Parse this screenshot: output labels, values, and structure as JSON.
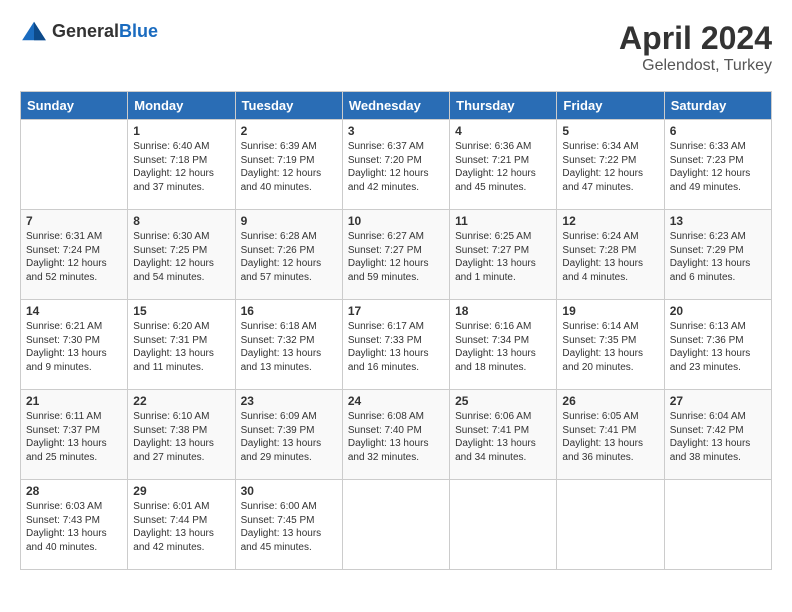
{
  "header": {
    "logo_general": "General",
    "logo_blue": "Blue",
    "month": "April 2024",
    "location": "Gelendost, Turkey"
  },
  "days_of_week": [
    "Sunday",
    "Monday",
    "Tuesday",
    "Wednesday",
    "Thursday",
    "Friday",
    "Saturday"
  ],
  "weeks": [
    [
      {
        "day": "",
        "info": ""
      },
      {
        "day": "1",
        "info": "Sunrise: 6:40 AM\nSunset: 7:18 PM\nDaylight: 12 hours\nand 37 minutes."
      },
      {
        "day": "2",
        "info": "Sunrise: 6:39 AM\nSunset: 7:19 PM\nDaylight: 12 hours\nand 40 minutes."
      },
      {
        "day": "3",
        "info": "Sunrise: 6:37 AM\nSunset: 7:20 PM\nDaylight: 12 hours\nand 42 minutes."
      },
      {
        "day": "4",
        "info": "Sunrise: 6:36 AM\nSunset: 7:21 PM\nDaylight: 12 hours\nand 45 minutes."
      },
      {
        "day": "5",
        "info": "Sunrise: 6:34 AM\nSunset: 7:22 PM\nDaylight: 12 hours\nand 47 minutes."
      },
      {
        "day": "6",
        "info": "Sunrise: 6:33 AM\nSunset: 7:23 PM\nDaylight: 12 hours\nand 49 minutes."
      }
    ],
    [
      {
        "day": "7",
        "info": "Sunrise: 6:31 AM\nSunset: 7:24 PM\nDaylight: 12 hours\nand 52 minutes."
      },
      {
        "day": "8",
        "info": "Sunrise: 6:30 AM\nSunset: 7:25 PM\nDaylight: 12 hours\nand 54 minutes."
      },
      {
        "day": "9",
        "info": "Sunrise: 6:28 AM\nSunset: 7:26 PM\nDaylight: 12 hours\nand 57 minutes."
      },
      {
        "day": "10",
        "info": "Sunrise: 6:27 AM\nSunset: 7:27 PM\nDaylight: 12 hours\nand 59 minutes."
      },
      {
        "day": "11",
        "info": "Sunrise: 6:25 AM\nSunset: 7:27 PM\nDaylight: 13 hours\nand 1 minute."
      },
      {
        "day": "12",
        "info": "Sunrise: 6:24 AM\nSunset: 7:28 PM\nDaylight: 13 hours\nand 4 minutes."
      },
      {
        "day": "13",
        "info": "Sunrise: 6:23 AM\nSunset: 7:29 PM\nDaylight: 13 hours\nand 6 minutes."
      }
    ],
    [
      {
        "day": "14",
        "info": "Sunrise: 6:21 AM\nSunset: 7:30 PM\nDaylight: 13 hours\nand 9 minutes."
      },
      {
        "day": "15",
        "info": "Sunrise: 6:20 AM\nSunset: 7:31 PM\nDaylight: 13 hours\nand 11 minutes."
      },
      {
        "day": "16",
        "info": "Sunrise: 6:18 AM\nSunset: 7:32 PM\nDaylight: 13 hours\nand 13 minutes."
      },
      {
        "day": "17",
        "info": "Sunrise: 6:17 AM\nSunset: 7:33 PM\nDaylight: 13 hours\nand 16 minutes."
      },
      {
        "day": "18",
        "info": "Sunrise: 6:16 AM\nSunset: 7:34 PM\nDaylight: 13 hours\nand 18 minutes."
      },
      {
        "day": "19",
        "info": "Sunrise: 6:14 AM\nSunset: 7:35 PM\nDaylight: 13 hours\nand 20 minutes."
      },
      {
        "day": "20",
        "info": "Sunrise: 6:13 AM\nSunset: 7:36 PM\nDaylight: 13 hours\nand 23 minutes."
      }
    ],
    [
      {
        "day": "21",
        "info": "Sunrise: 6:11 AM\nSunset: 7:37 PM\nDaylight: 13 hours\nand 25 minutes."
      },
      {
        "day": "22",
        "info": "Sunrise: 6:10 AM\nSunset: 7:38 PM\nDaylight: 13 hours\nand 27 minutes."
      },
      {
        "day": "23",
        "info": "Sunrise: 6:09 AM\nSunset: 7:39 PM\nDaylight: 13 hours\nand 29 minutes."
      },
      {
        "day": "24",
        "info": "Sunrise: 6:08 AM\nSunset: 7:40 PM\nDaylight: 13 hours\nand 32 minutes."
      },
      {
        "day": "25",
        "info": "Sunrise: 6:06 AM\nSunset: 7:41 PM\nDaylight: 13 hours\nand 34 minutes."
      },
      {
        "day": "26",
        "info": "Sunrise: 6:05 AM\nSunset: 7:41 PM\nDaylight: 13 hours\nand 36 minutes."
      },
      {
        "day": "27",
        "info": "Sunrise: 6:04 AM\nSunset: 7:42 PM\nDaylight: 13 hours\nand 38 minutes."
      }
    ],
    [
      {
        "day": "28",
        "info": "Sunrise: 6:03 AM\nSunset: 7:43 PM\nDaylight: 13 hours\nand 40 minutes."
      },
      {
        "day": "29",
        "info": "Sunrise: 6:01 AM\nSunset: 7:44 PM\nDaylight: 13 hours\nand 42 minutes."
      },
      {
        "day": "30",
        "info": "Sunrise: 6:00 AM\nSunset: 7:45 PM\nDaylight: 13 hours\nand 45 minutes."
      },
      {
        "day": "",
        "info": ""
      },
      {
        "day": "",
        "info": ""
      },
      {
        "day": "",
        "info": ""
      },
      {
        "day": "",
        "info": ""
      }
    ]
  ]
}
